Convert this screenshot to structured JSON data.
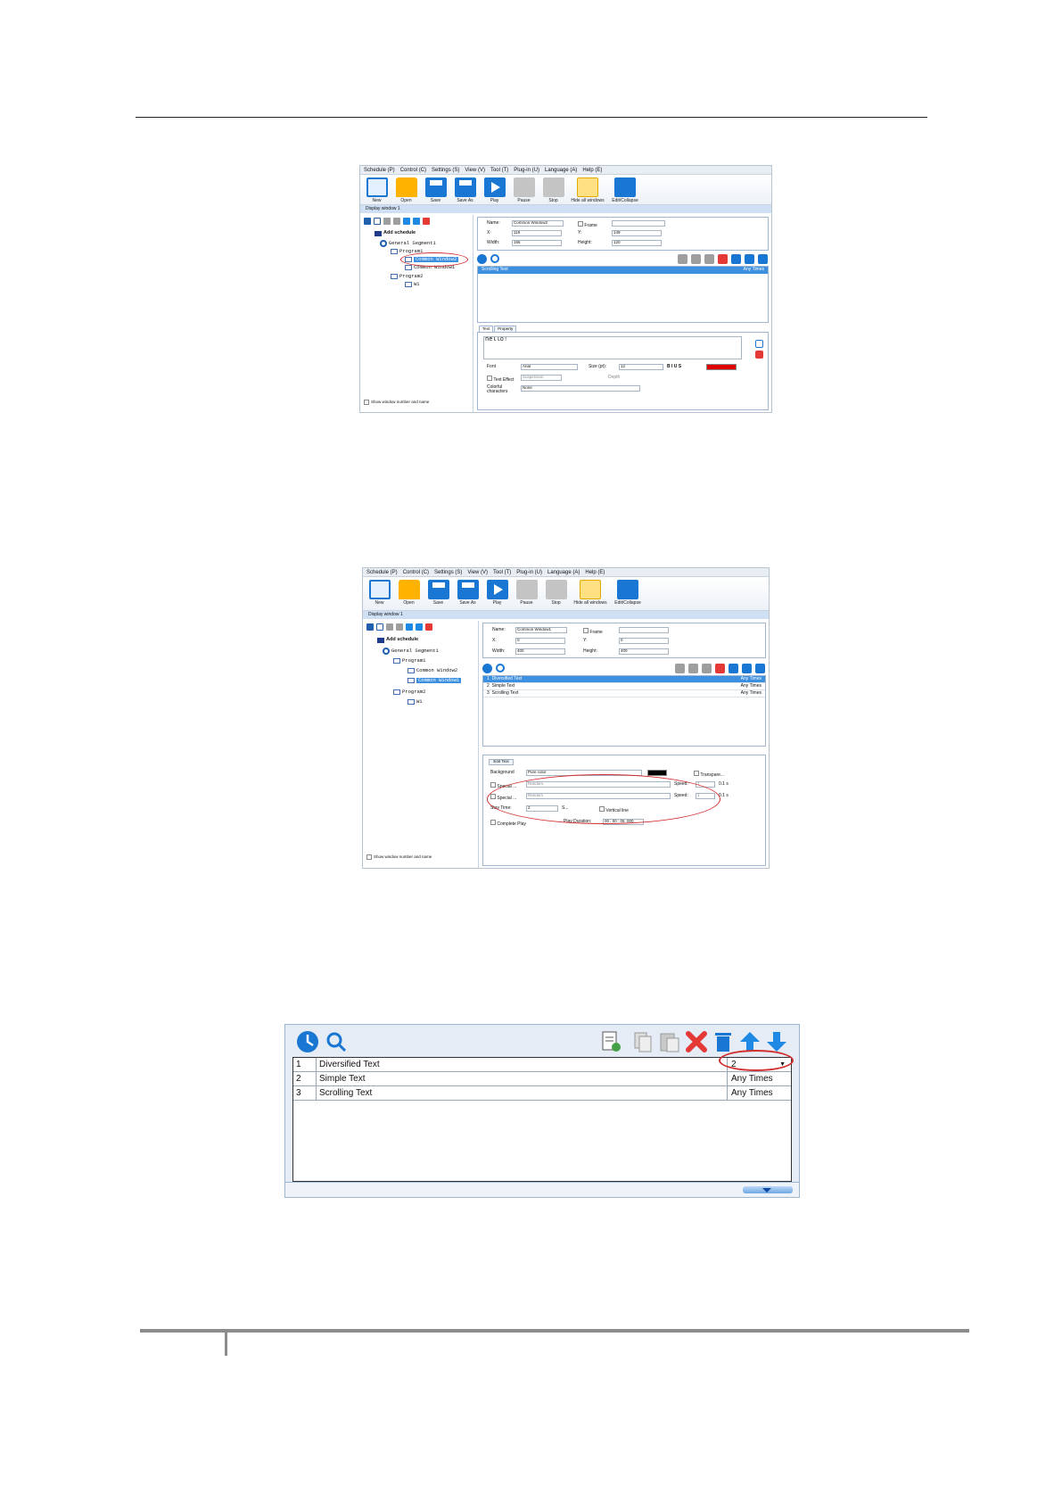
{
  "menu": [
    "Schedule (P)",
    "Control (C)",
    "Settings (S)",
    "View (V)",
    "Tool (T)",
    "Plug-in (U)",
    "Language (A)",
    "Help (E)"
  ],
  "toolbar": [
    "New",
    "Open",
    "Save",
    "Save As",
    "Play",
    "Pause",
    "Stop",
    "Hide all windows",
    "Edit/Collapse"
  ],
  "tab_label": "Display window 1",
  "tree": {
    "add_schedule": "Add schedule",
    "segment": "General Segment1",
    "program1": "Program1",
    "window2": "Common Window2",
    "window1": "Common Window1",
    "program2": "Program2",
    "w1": "W1"
  },
  "show_window_label": "Show window number and name",
  "shot1": {
    "name_label": "Name:",
    "name_value": "Common Window2",
    "frame_label": "Frame",
    "x_label": "X:",
    "x_value": "119",
    "y_label": "Y:",
    "y_value": "149",
    "width_label": "Width:",
    "width_value": "166",
    "height_label": "Height:",
    "height_value": "120",
    "list_item": "Scrolling Text",
    "list_times": "Any Times",
    "tab_text": "Text",
    "tab_property": "Property",
    "text_content": "hello!",
    "font_label": "Font",
    "font_value": "Arial",
    "size_label": "Size (pt):",
    "size_value": "12",
    "text_effect_label": "Text Effect",
    "effect_value": "Suspension",
    "depth_label": "Depth",
    "colorful_label": "Colorful characters",
    "colorful_value": "None"
  },
  "shot2": {
    "name_label": "Name:",
    "name_value": "Common Window1",
    "frame_label": "Frame",
    "x_label": "X:",
    "x_value": "0",
    "y_label": "Y:",
    "y_value": "0",
    "width_label": "Width:",
    "width_value": "400",
    "height_label": "Height:",
    "height_value": "400",
    "items": [
      {
        "n": "1",
        "name": "Diversified Text",
        "times": "Any Times"
      },
      {
        "n": "2",
        "name": "Simple Text",
        "times": "Any Times"
      },
      {
        "n": "3",
        "name": "Scrolling Text",
        "times": "Any Times"
      }
    ],
    "edit_text": "Edit Text",
    "background_label": "Background",
    "background_value": "Pure color",
    "transparent_label": "Transpare...",
    "special_label": "Special ...",
    "special_value": "Random",
    "speed_label": "Speed:",
    "speed_value": "1",
    "speed_unit": "0.1 s",
    "stay_label": "Stay Time:",
    "stay_value": "2",
    "stay_unit": "S...",
    "vertical_label": "Vertical line",
    "complete_label": "Complete Play",
    "duration_label": "Play Duration:",
    "duration_value": "00 : 00 : 05 .000"
  },
  "shot3": {
    "rows": [
      {
        "n": "1",
        "name": "Diversified Text",
        "times": "2"
      },
      {
        "n": "2",
        "name": "Simple Text",
        "times": "Any Times"
      },
      {
        "n": "3",
        "name": "Scrolling Text",
        "times": "Any Times"
      }
    ]
  },
  "colors": {
    "accent": "#3d8fe0",
    "highlight_oval": "#d32f2f",
    "toolbar_blue": "#1976d2"
  }
}
